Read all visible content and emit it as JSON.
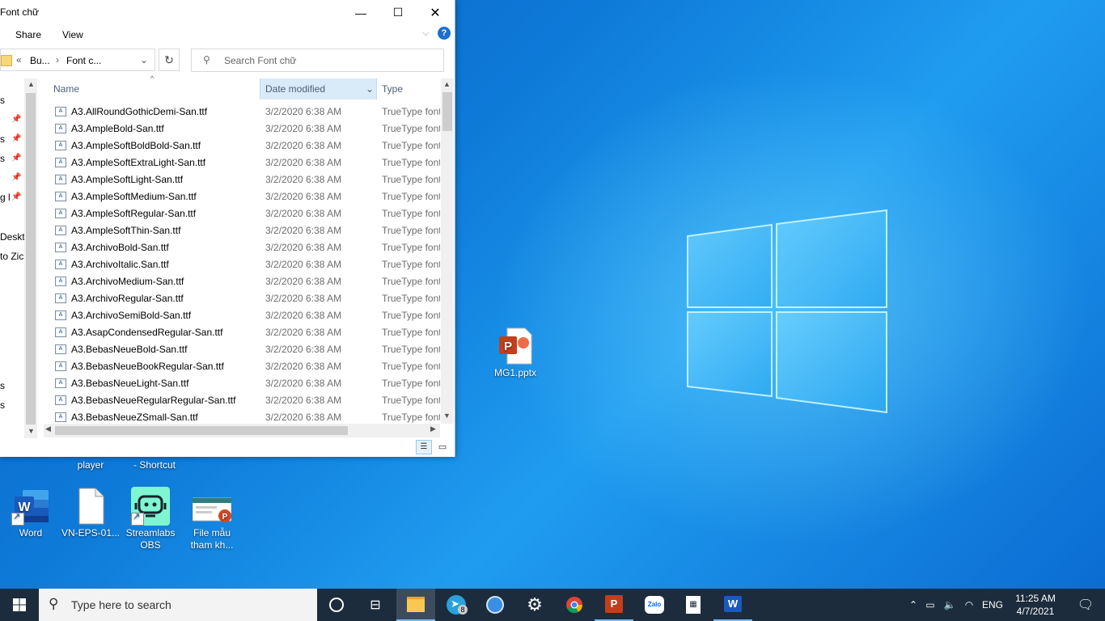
{
  "window": {
    "title": "Font chữ",
    "ribbon_tabs": [
      "Share",
      "View"
    ],
    "breadcrumb": {
      "back": "«",
      "part1": "Bu...",
      "sep": "›",
      "part2": "Font c..."
    },
    "search_placeholder": "Search Font chữ",
    "columns": {
      "name": "Name",
      "date": "Date modified",
      "type": "Type"
    },
    "nav_items": [
      {
        "label": "s",
        "pinned": false
      },
      {
        "label": "",
        "pinned": true
      },
      {
        "label": "s",
        "pinned": true
      },
      {
        "label": "s",
        "pinned": true
      },
      {
        "label": "",
        "pinned": true
      },
      {
        "label": "g l",
        "pinned": true
      },
      {
        "label": "Deskto",
        "pinned": false
      },
      {
        "label": "to Zic",
        "pinned": false
      },
      {
        "label": "s",
        "pinned": false
      },
      {
        "label": "s",
        "pinned": false
      }
    ],
    "files": [
      {
        "name": "A3.AllRoundGothicDemi-San.ttf",
        "date": "3/2/2020 6:38 AM",
        "type": "TrueType font"
      },
      {
        "name": "A3.AmpleBold-San.ttf",
        "date": "3/2/2020 6:38 AM",
        "type": "TrueType font"
      },
      {
        "name": "A3.AmpleSoftBoldBold-San.ttf",
        "date": "3/2/2020 6:38 AM",
        "type": "TrueType font"
      },
      {
        "name": "A3.AmpleSoftExtraLight-San.ttf",
        "date": "3/2/2020 6:38 AM",
        "type": "TrueType font"
      },
      {
        "name": "A3.AmpleSoftLight-San.ttf",
        "date": "3/2/2020 6:38 AM",
        "type": "TrueType font"
      },
      {
        "name": "A3.AmpleSoftMedium-San.ttf",
        "date": "3/2/2020 6:38 AM",
        "type": "TrueType font"
      },
      {
        "name": "A3.AmpleSoftRegular-San.ttf",
        "date": "3/2/2020 6:38 AM",
        "type": "TrueType font"
      },
      {
        "name": "A3.AmpleSoftThin-San.ttf",
        "date": "3/2/2020 6:38 AM",
        "type": "TrueType font"
      },
      {
        "name": "A3.ArchivoBold-San.ttf",
        "date": "3/2/2020 6:38 AM",
        "type": "TrueType font"
      },
      {
        "name": "A3.ArchivoItalic.San.ttf",
        "date": "3/2/2020 6:38 AM",
        "type": "TrueType font"
      },
      {
        "name": "A3.ArchivoMedium-San.ttf",
        "date": "3/2/2020 6:38 AM",
        "type": "TrueType font"
      },
      {
        "name": "A3.ArchivoRegular-San.ttf",
        "date": "3/2/2020 6:38 AM",
        "type": "TrueType font"
      },
      {
        "name": "A3.ArchivoSemiBold-San.ttf",
        "date": "3/2/2020 6:38 AM",
        "type": "TrueType font"
      },
      {
        "name": "A3.AsapCondensedRegular-San.ttf",
        "date": "3/2/2020 6:38 AM",
        "type": "TrueType font"
      },
      {
        "name": "A3.BebasNeueBold-San.ttf",
        "date": "3/2/2020 6:38 AM",
        "type": "TrueType font"
      },
      {
        "name": "A3.BebasNeueBookRegular-San.ttf",
        "date": "3/2/2020 6:38 AM",
        "type": "TrueType font"
      },
      {
        "name": "A3.BebasNeueLight-San.ttf",
        "date": "3/2/2020 6:38 AM",
        "type": "TrueType font"
      },
      {
        "name": "A3.BebasNeueRegularRegular-San.ttf",
        "date": "3/2/2020 6:38 AM",
        "type": "TrueType font"
      },
      {
        "name": "A3.BebasNeueZSmall-San.ttf",
        "date": "3/2/2020 6:38 AM",
        "type": "TrueType font"
      }
    ]
  },
  "desktop": {
    "partial_labels": {
      "player": "player",
      "shortcut": "- Shortcut"
    },
    "icons": {
      "word": "Word",
      "vneps": "VN-EPS-01...",
      "streamlabs": "Streamlabs OBS",
      "filemau": "File mẫu tham kh...",
      "mg1": "MG1.pptx"
    }
  },
  "taskbar": {
    "search_placeholder": "Type here to search",
    "telegram_badge": "8",
    "language": "ENG",
    "time": "11:25 AM",
    "date": "4/7/2021"
  },
  "colors": {
    "accent": "#0078d7",
    "taskbar": "#1c2c3c",
    "selected_column": "#d9ebf9"
  }
}
